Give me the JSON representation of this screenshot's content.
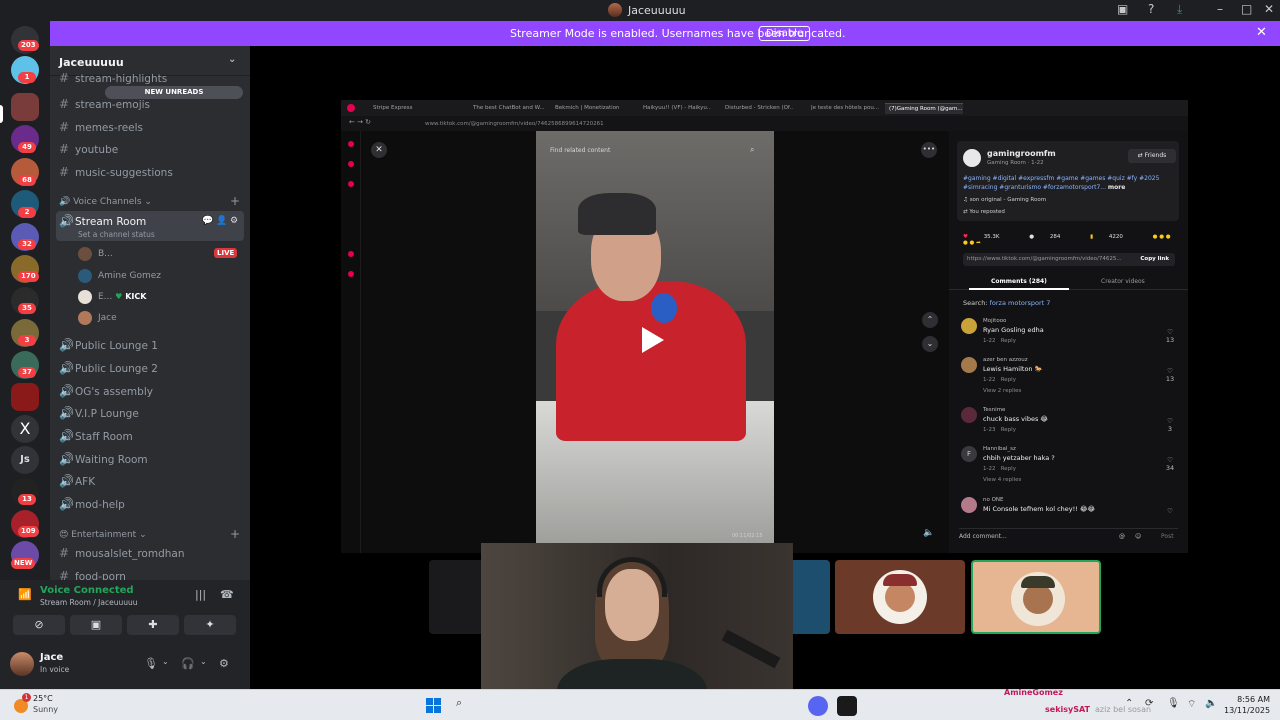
{
  "window": {
    "title": "Jaceuuuuu"
  },
  "banner": {
    "message": "Streamer Mode is enabled. Usernames have been truncated.",
    "disable_label": "Disable"
  },
  "guild_badges": [
    "203",
    "1",
    "49",
    "68",
    "2",
    "32",
    "170",
    "35",
    "3",
    "37",
    "13",
    "109",
    "NEW"
  ],
  "guild_text_label": "Js",
  "server": {
    "name": "Jaceuuuuu",
    "new_unreads": "NEW UNREADS"
  },
  "channels": {
    "text_top": [
      "stream-highlights",
      "stream-emojis",
      "memes-reels",
      "youtube",
      "music-suggestions"
    ],
    "voice_category": "Voice Channels",
    "stream_room": "Stream Room",
    "channel_status": "Set a channel status",
    "members": [
      {
        "name": "B...",
        "badge": "LIVE"
      },
      {
        "name": "Amine Gomez",
        "badge": ""
      },
      {
        "name": "E...",
        "badge": "KICK"
      },
      {
        "name": "Jace",
        "badge": ""
      }
    ],
    "voice_rest": [
      "Public Lounge 1",
      "Public Lounge 2",
      "OG's assembly",
      "V.I.P Lounge",
      "Staff Room",
      "Waiting Room",
      "AFK",
      "mod-help"
    ],
    "ent_category": "Entertainment",
    "ent_channels": [
      "mousalslet_romdhan",
      "food-porn"
    ]
  },
  "voice_panel": {
    "title": "Voice Connected",
    "subtitle": "Stream Room / Jaceuuuuu"
  },
  "user": {
    "name": "Jace",
    "status": "In voice"
  },
  "browser": {
    "tabs": [
      "Stripe Express",
      "The best ChatBot and W...",
      "Bekmich | Monetization",
      "Haikyuu!! (VF) - Haikyu...",
      "Disturbed - Stricken (Of...",
      "Je teste des hôtels pou...",
      "(7)Gaming Room (@gam..."
    ],
    "url": "www.tiktok.com/@gamingroomfm/video/7462586899614720261"
  },
  "tiktok": {
    "find_related": "Find related content",
    "video_time": "00:11/02:15",
    "author": "gamingroomfm",
    "author_sub": "Gaming Room · 1-22",
    "friends_label": "Friends",
    "hashtags": "#gaming #digital #expressfm #game #games #quiz #fy #2025 #simracing #granturismo #forzamotorsport7...",
    "more_label": "more",
    "sound": "son original - Gaming Room",
    "reposted": "You reposted",
    "stats": [
      "35.3K",
      "284",
      "4220"
    ],
    "link": "https://www.tiktok.com/@gamingroomfm/video/74625...",
    "copy_link": "Copy link",
    "tab_comments": "Comments (284)",
    "tab_creator": "Creator videos",
    "search_label": "Search:",
    "search_term": "forza motorsport 7",
    "comments": [
      {
        "user": "Mojitooo",
        "text": "Ryan Gosling edha",
        "date": "1-22",
        "reply": "Reply",
        "likes": "13",
        "replies": ""
      },
      {
        "user": "azer ben azzouz",
        "text": "Lewis Hamilton 🐎",
        "date": "1-22",
        "reply": "Reply",
        "likes": "13",
        "replies": "View 2 replies"
      },
      {
        "user": "Tesnime",
        "text": "chuck bass vibes 😂",
        "date": "1-23",
        "reply": "Reply",
        "likes": "3",
        "replies": ""
      },
      {
        "user": "Hannibal_sz",
        "text": "chbih yetzaber haka ?",
        "date": "1-22",
        "reply": "Reply",
        "likes": "34",
        "replies": "View 4 replies"
      },
      {
        "user": "no ONE",
        "text": "Mi Console tefhem kol chey!! 😂😂",
        "date": "",
        "reply": "",
        "likes": "",
        "replies": ""
      }
    ],
    "add_comment": "Add comment...",
    "post": "Post"
  },
  "taskbar": {
    "weather_badge": "1",
    "temp": "25°C",
    "condition": "Sunny",
    "time": "8:56 AM",
    "date": "13/11/2025",
    "overlay_1": "AmineGomez",
    "overlay_2": "sekisySAT",
    "overlay_3": "aziz bel sosan"
  }
}
